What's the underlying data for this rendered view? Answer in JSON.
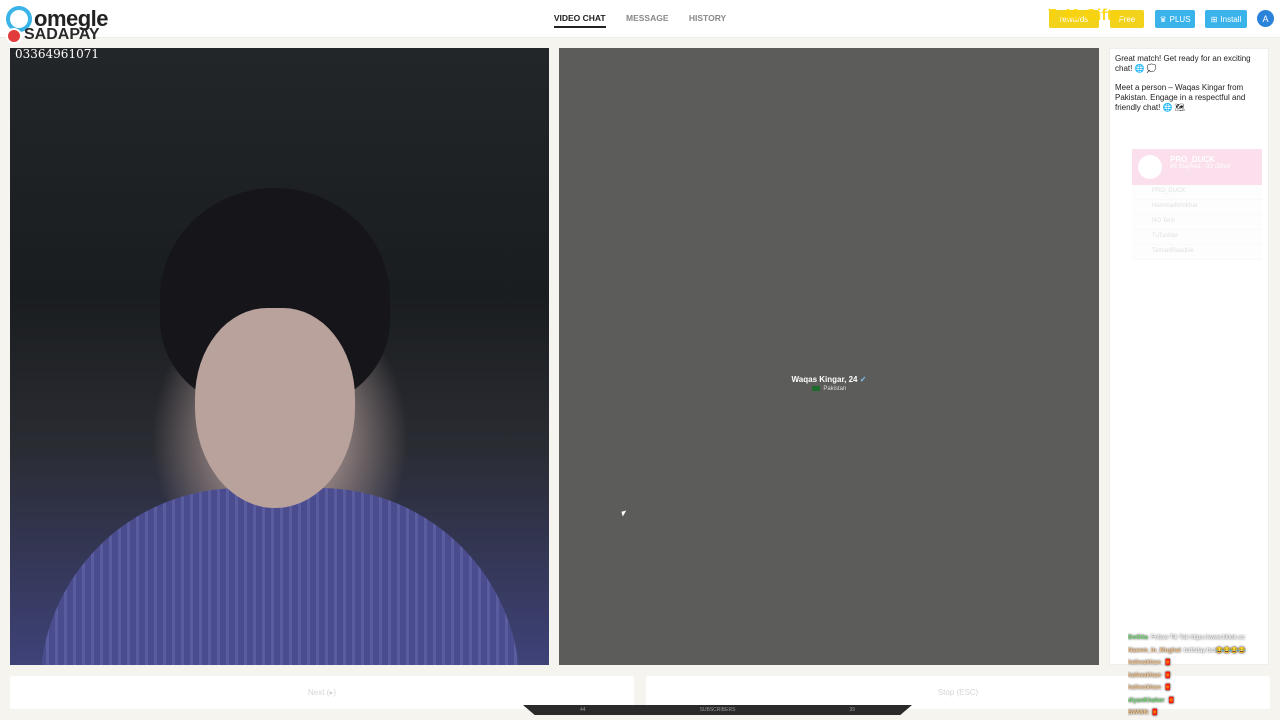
{
  "header": {
    "logo_word": "omegle",
    "logo_sub": "SADAPAY",
    "nav": [
      {
        "label": "VIDEO CHAT",
        "active": true
      },
      {
        "label": "MESSAGE",
        "active": false
      },
      {
        "label": "HISTORY",
        "active": false
      }
    ],
    "overlay_time": "7:40 Gifts",
    "btn_rewards": "rewards",
    "btn_free": "Free",
    "btn_plus": "PLUS",
    "btn_install": "Install",
    "avatar_initial": "A",
    "colors": {
      "accent_blue": "#39b3ea",
      "accent_yellow": "#f3d21c"
    }
  },
  "local_video": {
    "phone_overlay": "03364961071"
  },
  "remote_video": {
    "name": "Waqas Kingar, 24",
    "country": "Pakistan"
  },
  "chat": {
    "messages": [
      "Great match! Get ready for an exciting chat! 🌐 💭",
      "Meet a person – Waqas Kingar from Pakistan. Engage in a respectful and friendly chat! 🌐 🗺"
    ],
    "rank_card": {
      "title": "PRO_DUCK",
      "subtitle": "69 Stayfree · 93 Gifted",
      "rows": [
        "PRO_DUCK",
        "Hammadkhokhar",
        "NO Tech",
        "TuTasbier",
        "TamanIRaadive"
      ]
    }
  },
  "tiktok_feed": [
    {
      "name": "DoGlta",
      "text": ": Follow Tik Tok https://www.tiktok.co",
      "green": true
    },
    {
      "name": "Naeem_In_Mughal",
      "text": ": birthday bro😂😂😂😂",
      "green": false
    },
    {
      "name": "hafeezkhan",
      "text": ": 🧧",
      "green": false
    },
    {
      "name": "hafeezkhan",
      "text": ": 🧧",
      "green": false
    },
    {
      "name": "hafeezkhan",
      "text": ": 🧧",
      "green": false
    },
    {
      "name": "diyanKhaher",
      "text": ": 🧧",
      "green": true
    },
    {
      "name": "BWWN",
      "text": ": 🧧",
      "green": false
    }
  ],
  "controls": {
    "next_label": "Next (▸)",
    "stop_label": "Stop (ESC)"
  },
  "subscribers_bar": {
    "left": "44",
    "label": "SUBSCRIBERS",
    "right": "39"
  }
}
